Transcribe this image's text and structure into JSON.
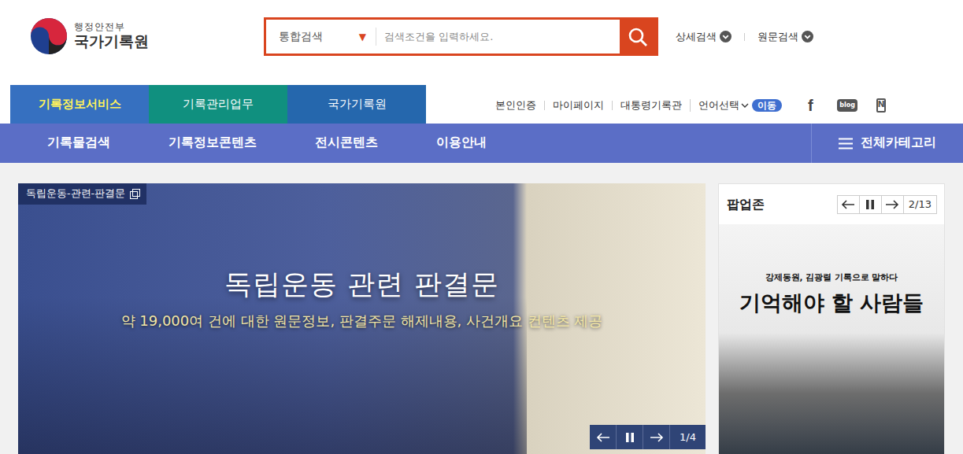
{
  "logo": {
    "ministry": "행정안전부",
    "name": "국가기록원"
  },
  "search": {
    "scope": "통합검색",
    "scope_arrow": "▼",
    "placeholder": "검색조건을 입력하세요."
  },
  "header_links": [
    {
      "label": "상세검색"
    },
    {
      "label": "원문검색"
    }
  ],
  "tabs": [
    {
      "label": "기록정보서비스",
      "selected": true
    },
    {
      "label": "기록관리업무",
      "selected": false
    },
    {
      "label": "국가기록원",
      "selected": false
    }
  ],
  "utility_links": [
    "본인인증",
    "마이페이지",
    "대통령기록관",
    "언어선택"
  ],
  "go_button": "이동",
  "social": {
    "facebook": "f",
    "blog": "blog",
    "post": "N"
  },
  "nav": {
    "items": [
      "기록물검색",
      "기록정보콘텐츠",
      "전시콘텐츠",
      "이용안내"
    ],
    "all_categories": "전체카테고리"
  },
  "banner": {
    "tag": "독립운동-관련-판결문",
    "title": "독립운동 관련 판결문",
    "subtitle": "약 19,000여 건에 대한 원문정보, 판결주문 해제내용, 사건개요 컨텐츠 제공",
    "counter": "1/4"
  },
  "popup": {
    "title": "팝업존",
    "counter": "2/13",
    "caption": "강제동원, 김광렬 기록으로 말하다",
    "headline": "기억해야 할 사람들"
  }
}
